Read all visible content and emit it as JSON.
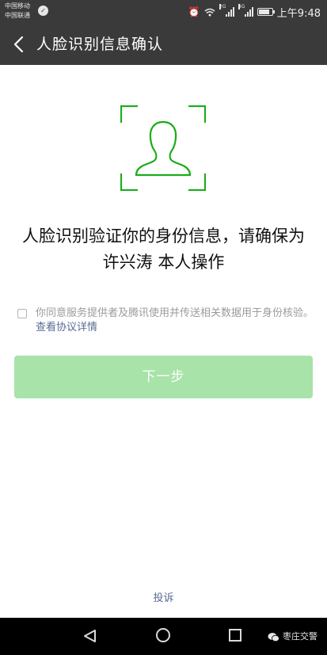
{
  "status_bar": {
    "carrier_1": "中国移动",
    "carrier_2": "中国联通",
    "signal_1_tag": "2G",
    "signal_2_tag": "4G",
    "battery_level": 0.85,
    "time": "上午9:48",
    "icons": [
      "wechat-icon",
      "alarm-icon",
      "wifi-icon",
      "signal-icon",
      "battery-icon"
    ]
  },
  "header": {
    "back_icon": "back-arrow-icon",
    "title": "人脸识别信息确认"
  },
  "main": {
    "face_icon": "face-frame-icon",
    "headline_line1": "人脸识别验证你的身份信息，请确保为",
    "headline_line2": "许兴涛 本人操作",
    "agreement_text": "你同意服务提供者及腾讯使用并传送相关数据用于身份核验。",
    "agreement_link": "查看协议详情",
    "agreement_checked": false,
    "next_button": "下一步",
    "next_enabled": false,
    "complaint_link": "投诉"
  },
  "nav_bar": {
    "icons": [
      "nav-back-icon",
      "nav-home-icon",
      "nav-recents-icon"
    ]
  },
  "watermark": {
    "text": "枣庄交警"
  },
  "colors": {
    "bar_bg": "#3a3a3a",
    "accent_green": "#1aad19",
    "button_disabled": "#a8e3a9",
    "link_blue": "#576b95"
  }
}
